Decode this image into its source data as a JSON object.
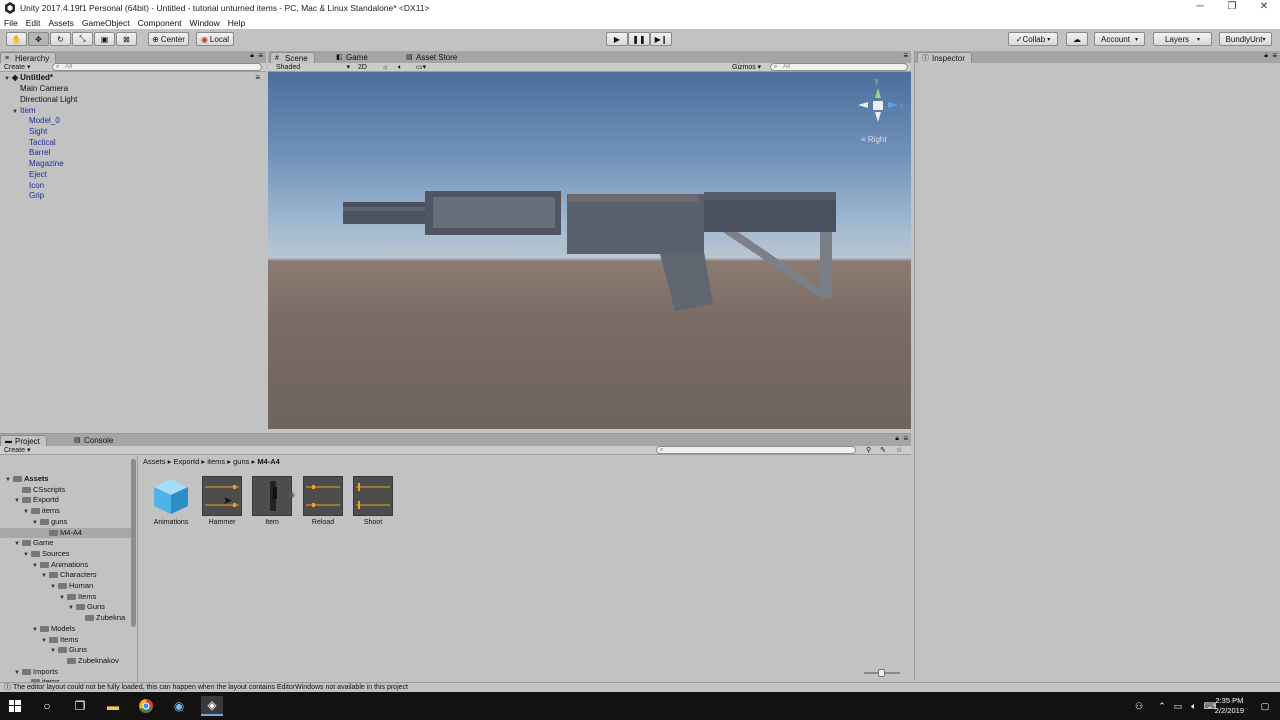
{
  "window": {
    "title": "Unity 2017.4.19f1 Personal (64bit) - Untitled - tutorial unturned items - PC, Mac & Linux Standalone* <DX11>"
  },
  "menu": [
    "File",
    "Edit",
    "Assets",
    "GameObject",
    "Component",
    "Window",
    "Help"
  ],
  "toolbar": {
    "pivot_label": "Center",
    "space_label": "Local",
    "collab_label": "Collab",
    "account_label": "Account",
    "layers_label": "Layers",
    "layout_label": "BundlyUnt"
  },
  "hierarchy": {
    "tab_label": "Hierarchy",
    "create_label": "Create",
    "search_placeholder": "All",
    "scene_name": "Untitled*",
    "items": [
      "Main Camera",
      "Directional Light"
    ],
    "item_parent": "Item",
    "children": [
      "Model_0",
      "Sight",
      "Tactical",
      "Barrel",
      "Magazine",
      "Eject",
      "Icon",
      "Grip"
    ]
  },
  "scene": {
    "tabs": [
      "Scene",
      "Game",
      "Asset Store"
    ],
    "shading": "Shaded",
    "mode_2d": "2D",
    "gizmos_label": "Gizmos",
    "search_placeholder": "All",
    "view_label": "Right",
    "axis_y": "y",
    "axis_z": "z"
  },
  "inspector": {
    "tab_label": "Inspector"
  },
  "project": {
    "tabs": [
      "Project",
      "Console"
    ],
    "create_label": "Create",
    "breadcrumb": [
      "Assets",
      "Exportd",
      "items",
      "guns",
      "M4-A4"
    ],
    "tree": [
      {
        "label": "Assets",
        "level": 0,
        "bold": true
      },
      {
        "label": "CSscripts",
        "level": 1
      },
      {
        "label": "Exportd",
        "level": 1
      },
      {
        "label": "items",
        "level": 2
      },
      {
        "label": "guns",
        "level": 3
      },
      {
        "label": "M4-A4",
        "level": 4,
        "selected": true
      },
      {
        "label": "Game",
        "level": 1
      },
      {
        "label": "Sources",
        "level": 2
      },
      {
        "label": "Animations",
        "level": 3
      },
      {
        "label": "Characters",
        "level": 4
      },
      {
        "label": "Human",
        "level": 5
      },
      {
        "label": "Items",
        "level": 6
      },
      {
        "label": "Guns",
        "level": 7
      },
      {
        "label": "Zubekna",
        "level": 8
      },
      {
        "label": "Models",
        "level": 3
      },
      {
        "label": "Items",
        "level": 4
      },
      {
        "label": "Guns",
        "level": 5
      },
      {
        "label": "Zubeknakov",
        "level": 6
      },
      {
        "label": "Imports",
        "level": 1
      },
      {
        "label": "items",
        "level": 2
      }
    ],
    "assets": [
      "Animations",
      "Hammer",
      "Item",
      "Reload",
      "Shoot"
    ]
  },
  "status": {
    "message": "The editor layout could not be fully loaded, this can happen when the layout contains EditorWindows not available in this project"
  },
  "taskbar": {
    "time": "2:35 PM",
    "date": "2/2/2019"
  },
  "colors": {
    "selection": "#3d6fc4",
    "scene_blue": "#1c2f9e",
    "anim_orange": "#f4a020"
  }
}
